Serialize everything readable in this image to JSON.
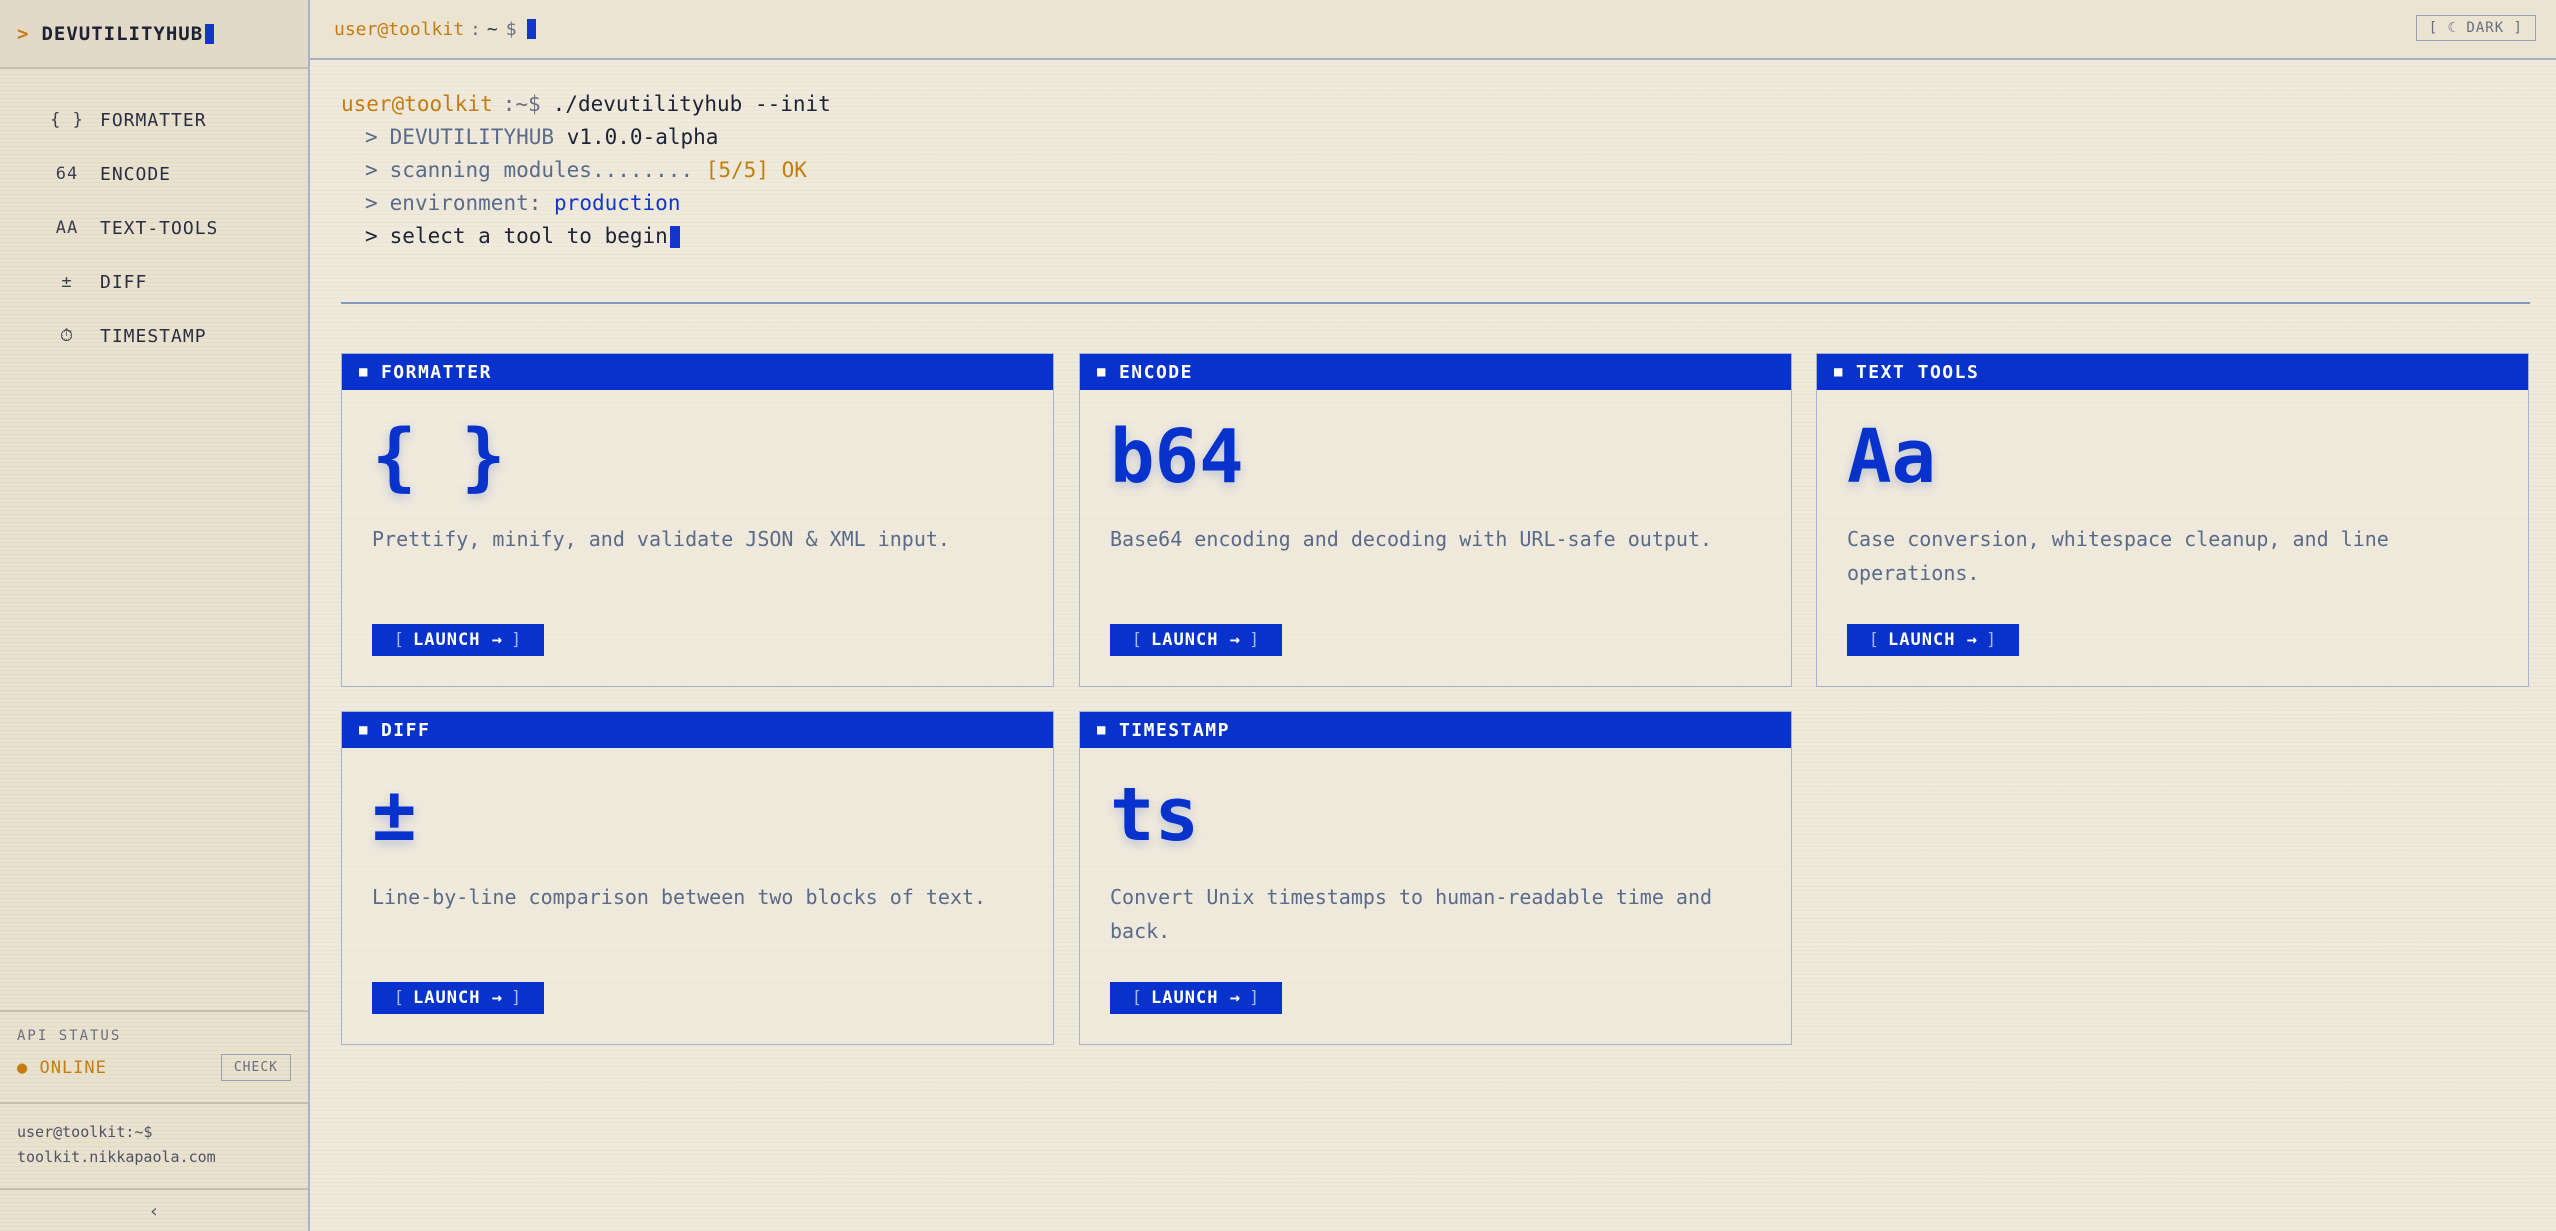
{
  "sidebar": {
    "brand": "DEVUTILITYHUB",
    "brand_prompt": ">",
    "items": [
      {
        "icon": "{ }",
        "label": "FORMATTER"
      },
      {
        "icon": "64",
        "label": "ENCODE"
      },
      {
        "icon": "AA",
        "label": "TEXT-TOOLS"
      },
      {
        "icon": "±",
        "label": "DIFF"
      },
      {
        "icon": "⏱",
        "label": "TIMESTAMP"
      }
    ],
    "api_status": {
      "label": "API STATUS",
      "status": "● ONLINE",
      "check_label": "CHECK"
    },
    "footer": {
      "line1": "user@toolkit:~$",
      "line2": "toolkit.nikkapaola.com"
    },
    "collapse_icon": "‹"
  },
  "topbar": {
    "user": "user@toolkit",
    "sep": ":",
    "path": "~",
    "dollar": "$",
    "theme_button": "[ ☾ DARK ]"
  },
  "terminal": {
    "user": "user@toolkit",
    "path": ":~$",
    "command": "./devutilityhub --init",
    "lines": {
      "version_name": "DEVUTILITYHUB",
      "version": "v1.0.0-alpha",
      "scan": "scanning modules........",
      "scan_result": "[5/5] OK",
      "env": "environment:",
      "env_value": "production",
      "select": "select a tool to begin"
    },
    "prompt": ">"
  },
  "cards": [
    {
      "title": "FORMATTER",
      "glyph": "{ }",
      "desc": "Prettify, minify, and validate JSON & XML input.",
      "launch": "LAUNCH →"
    },
    {
      "title": "ENCODE",
      "glyph": "b64",
      "desc": "Base64 encoding and decoding with URL-safe output.",
      "launch": "LAUNCH →"
    },
    {
      "title": "TEXT TOOLS",
      "glyph": "Aa",
      "desc": "Case conversion, whitespace cleanup, and line operations.",
      "launch": "LAUNCH →"
    },
    {
      "title": "DIFF",
      "glyph": "±",
      "desc": "Line-by-line comparison between two blocks of text.",
      "launch": "LAUNCH →"
    },
    {
      "title": "TIMESTAMP",
      "glyph": "ts",
      "desc": "Convert Unix timestamps to human-readable time and back.",
      "launch": "LAUNCH →"
    }
  ],
  "colors": {
    "accent": "#0733cc",
    "prompt": "#c47c10",
    "background": "#efeadc"
  }
}
